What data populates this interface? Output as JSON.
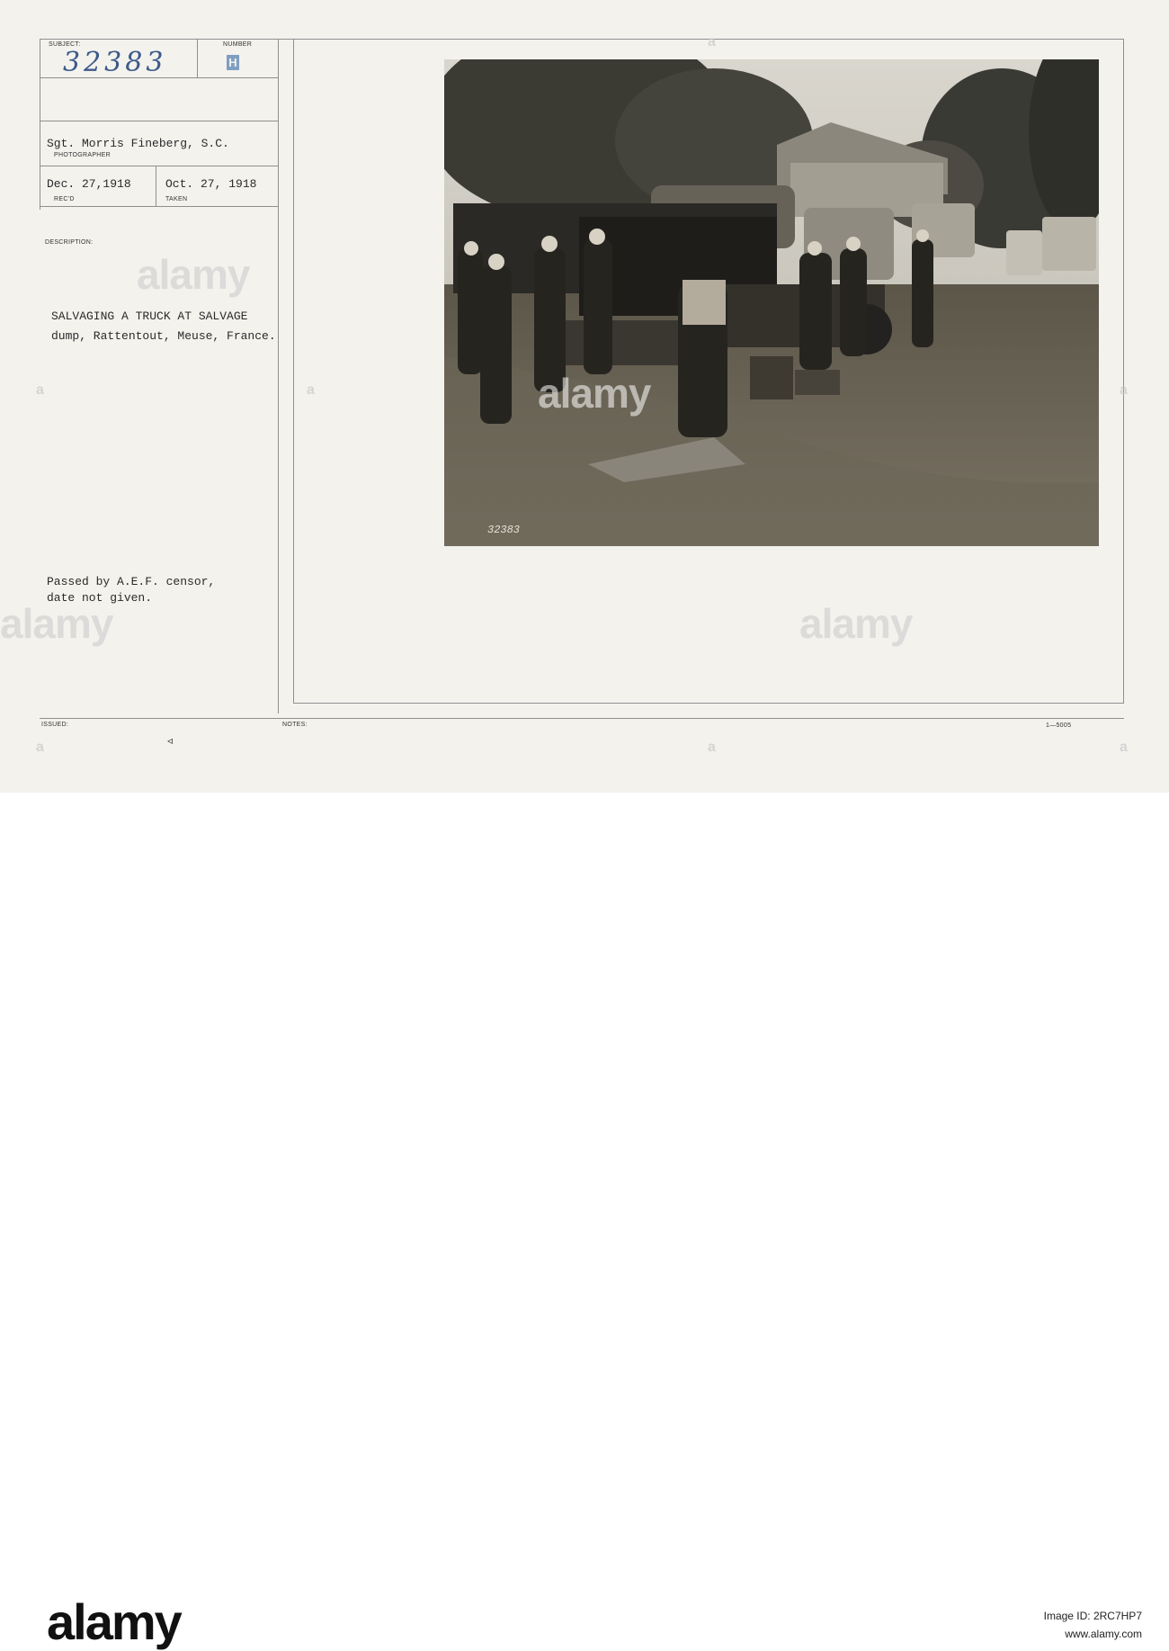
{
  "card": {
    "subject_label": "SUBJECT:",
    "subject_number": "32383",
    "number_label": "NUMBER",
    "number_stamp": "H",
    "photographer": "Sgt. Morris Fineberg, S.C.",
    "photographer_label": "PHOTOGRAPHER",
    "received_date": "Dec. 27,1918",
    "received_label": "REC'D",
    "taken_date": "Oct. 27, 1918",
    "taken_label": "TAKEN",
    "description_label": "DESCRIPTION:",
    "description_line1": "SALVAGING A TRUCK AT SALVAGE",
    "description_line2": "dump, Rattentout, Meuse, France.",
    "censor_line1": "Passed by A.E.F. censor,",
    "censor_line2": "date not given.",
    "issued_label": "ISSUED:",
    "issued_mark": "◃",
    "notes_label": "NOTES:",
    "form_number": "1—5005",
    "photo_caption_number": "32383"
  },
  "watermark": {
    "text": "alamy"
  },
  "footer": {
    "brand": "alamy",
    "image_id_label": "Image ID: 2RC7HP7",
    "site": "www.alamy.com"
  }
}
